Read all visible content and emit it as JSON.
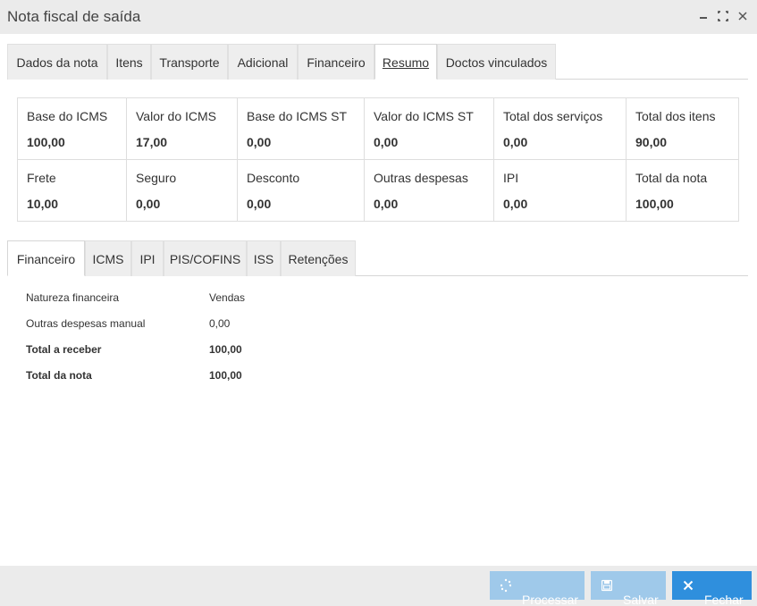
{
  "window": {
    "title": "Nota fiscal de saída",
    "controls": [
      "minimize",
      "maximize",
      "close"
    ]
  },
  "main_tabs": [
    {
      "label": "Dados da nota"
    },
    {
      "label": "Itens"
    },
    {
      "label": "Transporte"
    },
    {
      "label": "Adicional"
    },
    {
      "label": "Financeiro"
    },
    {
      "label": "Resumo",
      "active": true
    },
    {
      "label": "Doctos vinculados"
    }
  ],
  "summary": {
    "row1": [
      {
        "label": "Base do ICMS",
        "value": "100,00"
      },
      {
        "label": "Valor do ICMS",
        "value": "17,00"
      },
      {
        "label": "Base do ICMS ST",
        "value": "0,00"
      },
      {
        "label": "Valor do ICMS ST",
        "value": "0,00"
      },
      {
        "label": "Total dos serviços",
        "value": "0,00"
      },
      {
        "label": "Total dos itens",
        "value": "90,00"
      }
    ],
    "row2": [
      {
        "label": "Frete",
        "value": "10,00"
      },
      {
        "label": "Seguro",
        "value": "0,00"
      },
      {
        "label": "Desconto",
        "value": "0,00"
      },
      {
        "label": "Outras despesas",
        "value": "0,00"
      },
      {
        "label": "IPI",
        "value": "0,00"
      },
      {
        "label": "Total da nota",
        "value": "100,00"
      }
    ]
  },
  "sub_tabs": [
    {
      "label": "Financeiro",
      "active": true
    },
    {
      "label": "ICMS"
    },
    {
      "label": "IPI"
    },
    {
      "label": "PIS/COFINS"
    },
    {
      "label": "ISS"
    },
    {
      "label": "Retenções"
    }
  ],
  "financeiro": [
    {
      "label": "Natureza financeira",
      "value": "Vendas"
    },
    {
      "label": "Outras despesas manual",
      "value": "0,00"
    },
    {
      "label": "Total a receber",
      "value": "100,00"
    },
    {
      "label": "Total da nota",
      "value": "100,00"
    }
  ],
  "footer": {
    "processar_label": "Processar",
    "salvar_label": "Salvar",
    "fechar_label": "Fechar"
  },
  "colors": {
    "button_disabled": "#9fc9ea",
    "button_primary": "#2f8fdd",
    "titlebar_bg": "#ebebeb"
  }
}
